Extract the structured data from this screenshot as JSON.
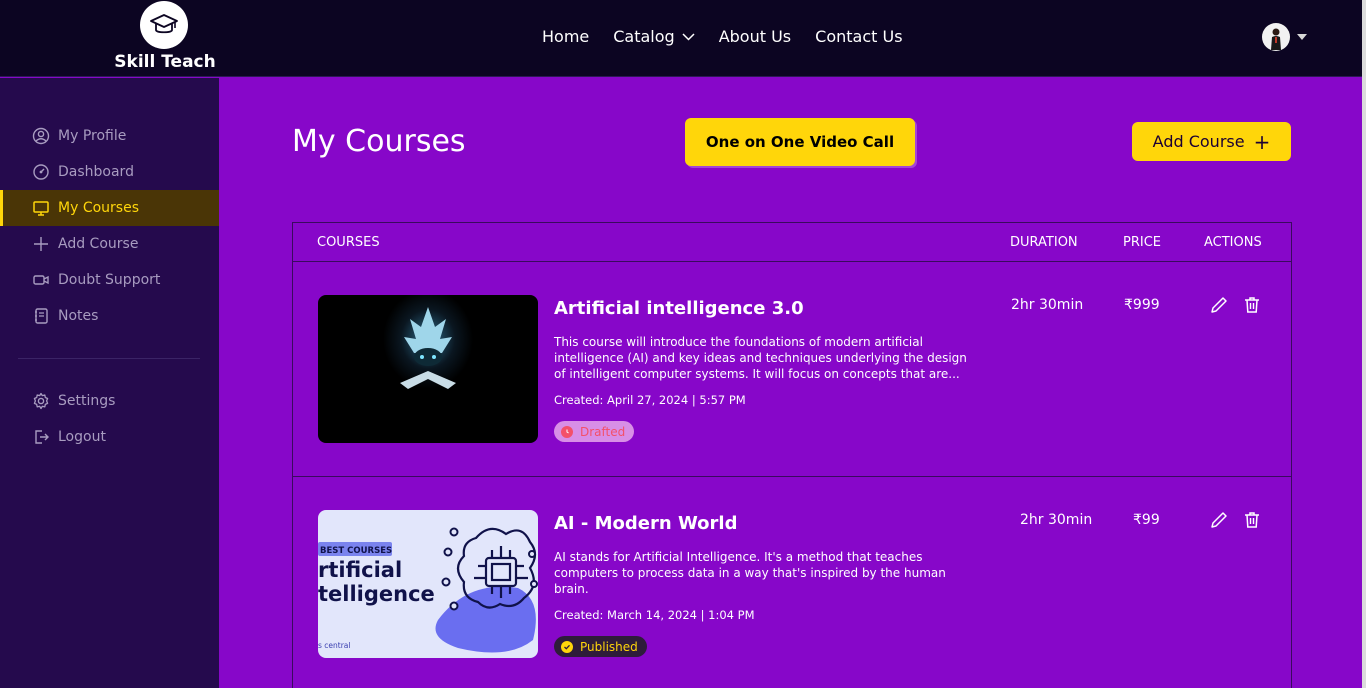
{
  "brand": {
    "name": "Skill Teach"
  },
  "nav": {
    "items": [
      {
        "label": "Home"
      },
      {
        "label": "Catalog"
      },
      {
        "label": "About Us"
      },
      {
        "label": "Contact Us"
      }
    ]
  },
  "sidebar": {
    "items": [
      {
        "label": "My Profile",
        "icon": "user-circle-icon"
      },
      {
        "label": "Dashboard",
        "icon": "gauge-icon"
      },
      {
        "label": "My Courses",
        "icon": "monitor-icon",
        "active": true
      },
      {
        "label": "Add Course",
        "icon": "plus-icon"
      },
      {
        "label": "Doubt Support",
        "icon": "video-icon"
      },
      {
        "label": "Notes",
        "icon": "notebook-icon"
      }
    ],
    "bottom": [
      {
        "label": "Settings",
        "icon": "gear-icon"
      },
      {
        "label": "Logout",
        "icon": "logout-icon"
      }
    ]
  },
  "main": {
    "title": "My Courses",
    "call_button": "One on One Video Call",
    "add_button": "Add Course"
  },
  "table": {
    "headers": {
      "courses": "COURSES",
      "duration": "DURATION",
      "price": "PRICE",
      "actions": "ACTIONS"
    },
    "rows": [
      {
        "title": "Artificial intelligence 3.0",
        "description": "This course will introduce the foundations of modern artificial intelligence (AI) and key ideas and techniques underlying the design of intelligent computer systems. It will focus on concepts that are...",
        "created": "Created: April 27, 2024 | 5:57 PM",
        "status": "Drafted",
        "duration": "2hr 30min",
        "price": "₹999"
      },
      {
        "title": "AI - Modern World",
        "description": "AI stands for Artificial Intelligence. It's a method that teaches computers to process data in a way that's inspired by the human brain.",
        "created": "Created: March 14, 2024 | 1:04 PM",
        "status": "Published",
        "duration": "2hr 30min",
        "price": "₹99",
        "thumb": {
          "tag": "BEST COURSES",
          "line1": "rtificial",
          "line2": "telligence",
          "footer": "s central"
        }
      }
    ]
  },
  "colors": {
    "page_bg": "#8707c9",
    "topbar_bg": "#0c0522",
    "sidebar_bg": "#250a4d",
    "accent": "#ffd60a",
    "draft": "#f3506a"
  }
}
